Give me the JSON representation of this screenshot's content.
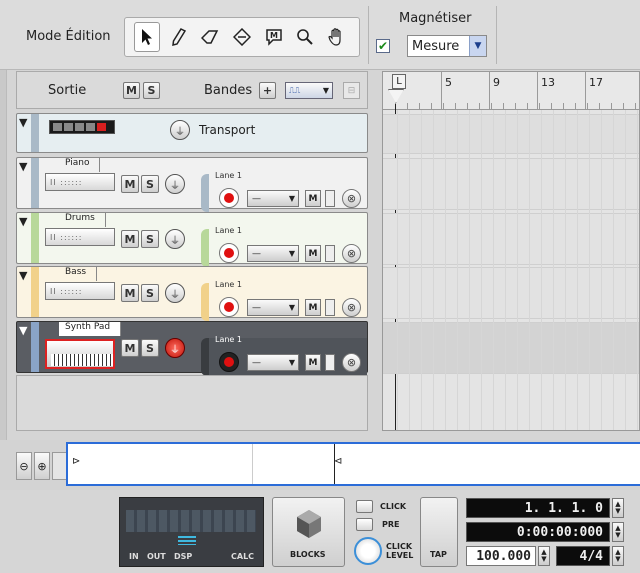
{
  "toolbar": {
    "mode_label": "Mode Édition",
    "snap_label": "Magnétiser",
    "snap_checked": true,
    "snap_value": "Mesure"
  },
  "header": {
    "output_label": "Sortie",
    "m": "M",
    "s": "S",
    "lanes_label": "Bandes",
    "plus": "+"
  },
  "transport_track": {
    "name": "Transport"
  },
  "tracks": [
    {
      "name": "Piano",
      "lane": "Lane 1",
      "color": "#a9b9c7",
      "bg": "#f1f1f1"
    },
    {
      "name": "Drums",
      "lane": "Lane 1",
      "color": "#b8d89a",
      "bg": "#f3f7ee"
    },
    {
      "name": "Bass",
      "lane": "Lane 1",
      "color": "#f1d18a",
      "bg": "#fbf4e3"
    },
    {
      "name": "Synth Pad",
      "lane": "Lane 1",
      "color": "#8aa4c7",
      "bg": "#5a5d63"
    }
  ],
  "ruler": {
    "marks": [
      "5",
      "9",
      "13",
      "17"
    ],
    "loop_l": "L"
  },
  "transport": {
    "meter_labels": [
      "IN",
      "OUT",
      "DSP",
      "CALC"
    ],
    "blocks": "BLOCKS",
    "click": "CLICK",
    "pre": "PRE",
    "click_level": "CLICK LEVEL",
    "tap": "TAP",
    "position": "1. 1. 1.   0",
    "time": "0:00:00:000",
    "tempo": "100.000",
    "signature": "4/4"
  },
  "icons": {
    "arrow": "arrow-tool-icon",
    "pencil": "pencil-tool-icon",
    "eraser": "eraser-tool-icon",
    "razor": "razor-tool-icon",
    "mute": "mute-tool-icon",
    "magnify": "magnify-tool-icon",
    "hand": "hand-tool-icon"
  }
}
